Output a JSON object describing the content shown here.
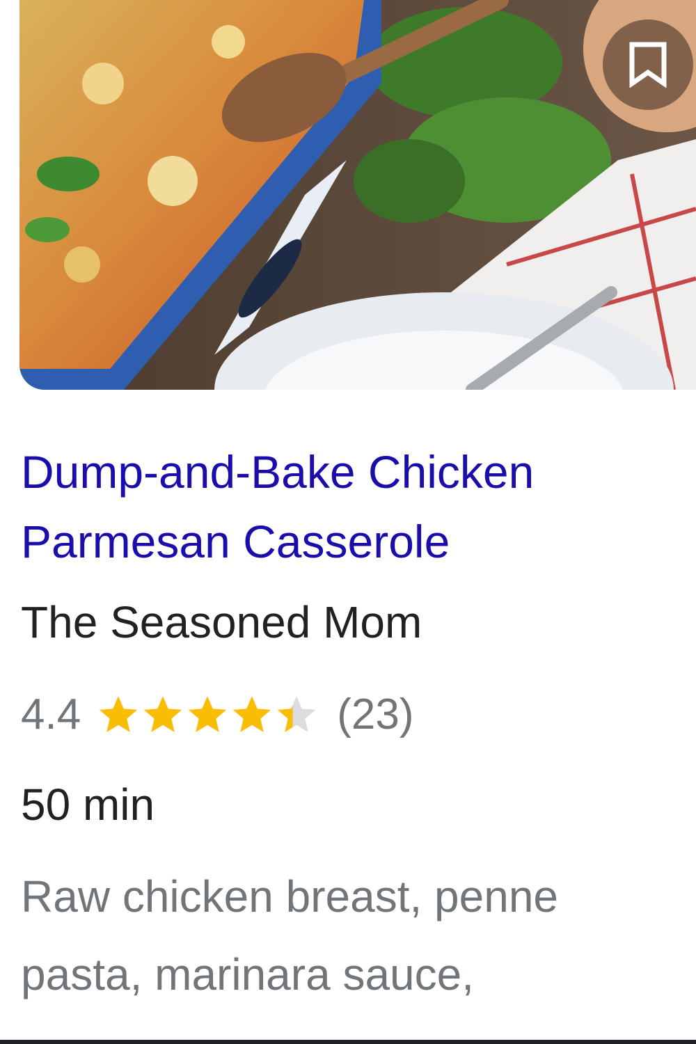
{
  "card": {
    "image_alt": "Dump-and-Bake Chicken Parmesan Casserole photo",
    "bookmark_icon": "bookmark-outline-icon",
    "title": "Dump-and-Bake Chicken Parmesan Casserole",
    "source": "The Seasoned Mom",
    "rating": {
      "value": "4.4",
      "stars_filled": 4.4,
      "stars_total": 5,
      "count": "(23)",
      "star_color": "#fbbc04",
      "star_empty_color": "#dadce0"
    },
    "total_time": "50 min",
    "ingredients": "Raw chicken breast, penne pasta, marinara sauce,"
  },
  "colors": {
    "title_link": "#1a0dab",
    "primary_text": "#202124",
    "secondary_text": "#70757a"
  }
}
